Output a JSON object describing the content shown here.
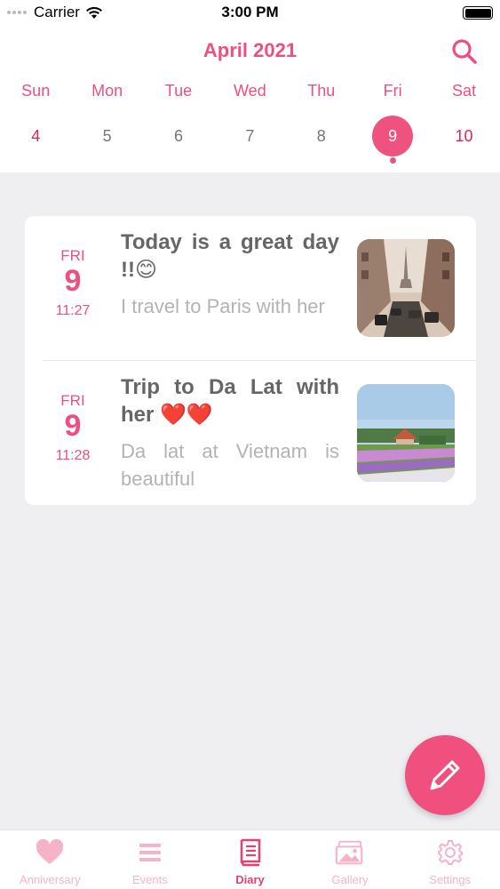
{
  "status": {
    "carrier": "Carrier",
    "time": "3:00 PM"
  },
  "header": {
    "month": "April 2021"
  },
  "week": {
    "days": [
      "Sun",
      "Mon",
      "Tue",
      "Wed",
      "Thu",
      "Fri",
      "Sat"
    ],
    "dates": [
      "4",
      "5",
      "6",
      "7",
      "8",
      "9",
      "10"
    ],
    "selected": "9"
  },
  "entries": [
    {
      "weekday": "FRI",
      "day": "9",
      "time": "11:27",
      "title": "Today is a great day !!😊",
      "body": "I travel to Paris with her",
      "image": "paris-street-photo"
    },
    {
      "weekday": "FRI",
      "day": "9",
      "time": "11:28",
      "title": "Trip to Da Lat with her ❤️❤️",
      "body": "Da lat at Vietnam is beautiful",
      "image": "dalat-flower-field-photo"
    }
  ],
  "tabs": [
    {
      "label": "Anniversary",
      "icon": "heart-icon"
    },
    {
      "label": "Events",
      "icon": "list-icon"
    },
    {
      "label": "Diary",
      "icon": "book-icon",
      "active": true
    },
    {
      "label": "Gallery",
      "icon": "gallery-icon"
    },
    {
      "label": "Settings",
      "icon": "gear-icon"
    }
  ],
  "colors": {
    "accent": "#ec4f80",
    "sunday": "#e02651",
    "tab_inactive": "#f6b3c7"
  }
}
